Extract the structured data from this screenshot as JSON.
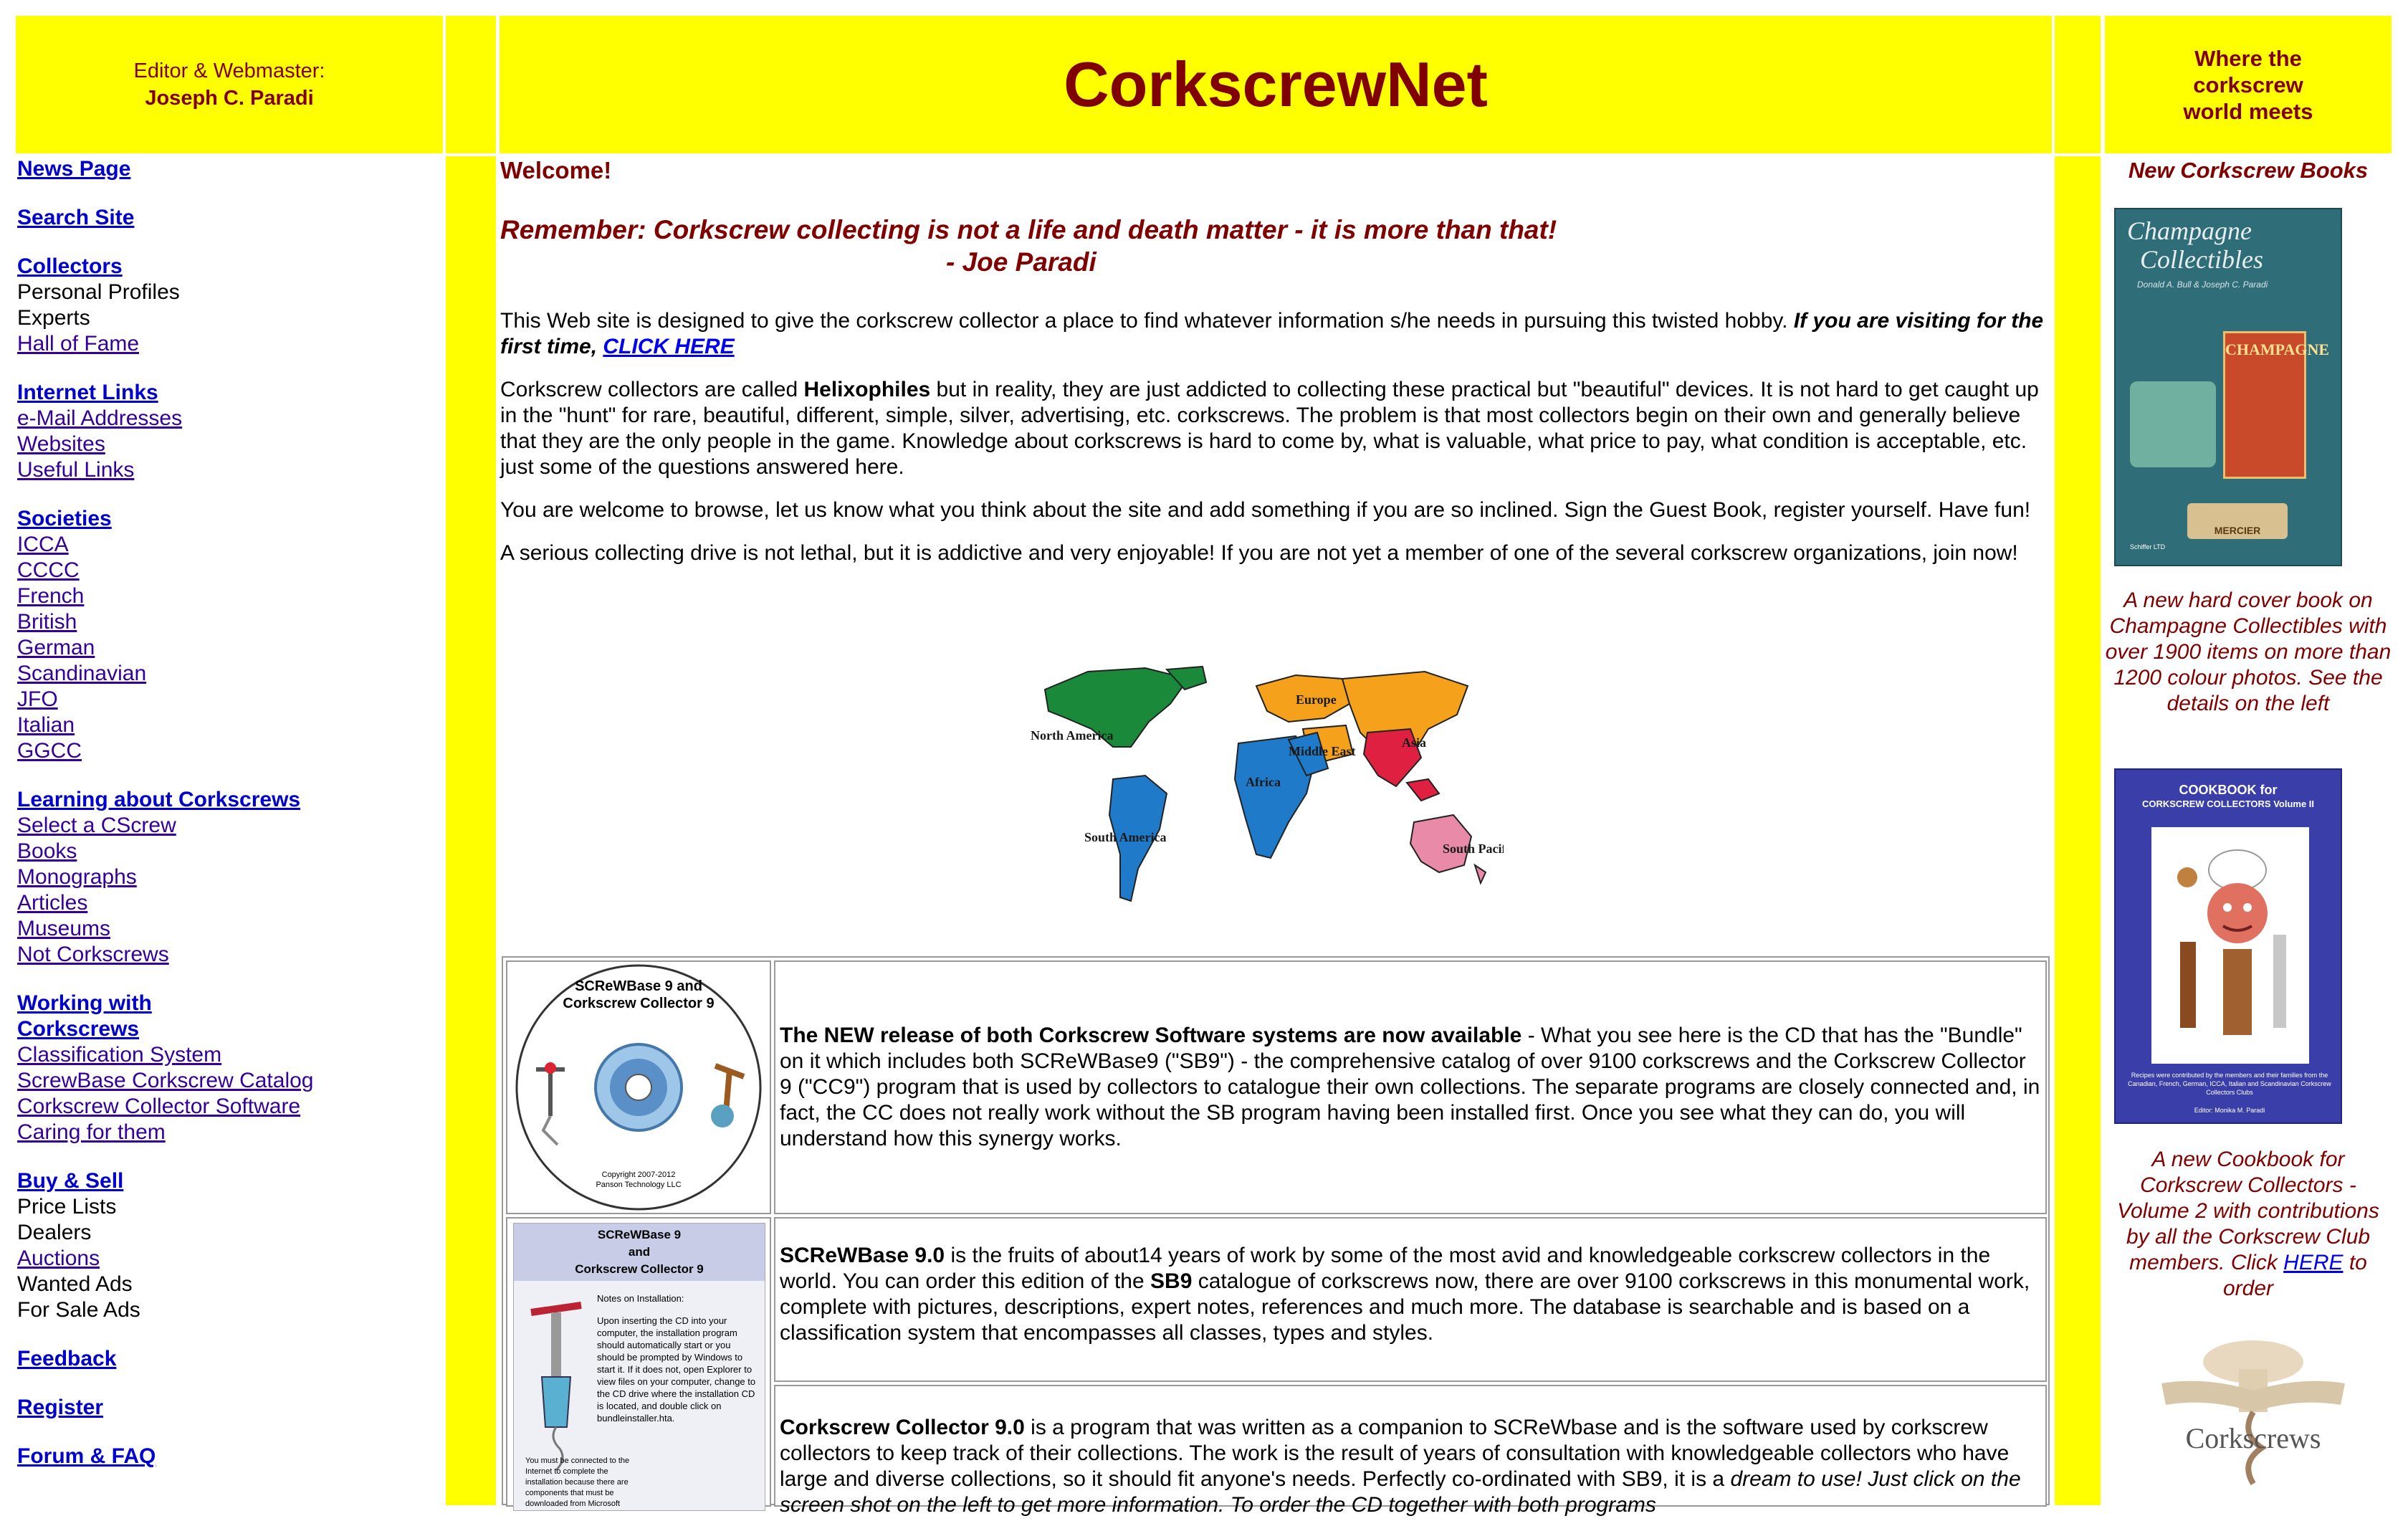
{
  "header": {
    "editor_label": "Editor & Webmaster:",
    "editor_name": "Joseph C. Paradi",
    "site_title": "CorkscrewNet",
    "tagline": "Where the corkscrew world meets"
  },
  "nav": {
    "news": "News Page",
    "search": "Search Site",
    "collectors": "Collectors",
    "personal_profiles": "Personal Profiles",
    "experts": "Experts",
    "hall_of_fame": "Hall of Fame",
    "internet_links": "Internet Links",
    "email_addresses": "e-Mail Addresses",
    "websites": "Websites",
    "useful_links": "Useful Links",
    "societies": "Societies",
    "society_items": [
      "ICCA",
      "CCCC",
      "French",
      "British",
      "German",
      "Scandinavian",
      "JFO",
      "Italian",
      "GGCC"
    ],
    "learning": "Learning about Corkscrews",
    "learning_items": [
      "Select a CScrew",
      "Books",
      "Monographs",
      "Articles",
      "Museums",
      "Not Corkscrews"
    ],
    "working_1": "Working with",
    "working_2": "Corkscrews",
    "working_items": [
      "Classification System",
      "ScrewBase Corkscrew Catalog",
      "Corkscrew Collector Software",
      "Caring for them"
    ],
    "buysell": "Buy & Sell",
    "price_lists": "Price Lists",
    "dealers": "Dealers",
    "auctions": "Auctions",
    "wanted_ads": "Wanted Ads",
    "for_sale_ads": "For Sale Ads",
    "feedback": "Feedback",
    "register": "Register",
    "forum": "Forum & FAQ"
  },
  "main": {
    "welcome": "Welcome!",
    "quote": "Remember: Corkscrew collecting is not a life and death matter - it is more than that!",
    "quote_author": "- Joe Paradi",
    "p1_text": "This Web site is designed to give the corkscrew collector a place to find whatever information s/he needs in pursuing this twisted hobby.  ",
    "p1_bold": "If you are visiting for the first time, ",
    "p1_link": "CLICK HERE",
    "p2_pre": "Corkscrew collectors are called ",
    "p2_bold": "Helixophiles",
    "p2_post": " but in reality, they are just addicted to collecting these practical but \"beautiful\" devices.  It is not hard to get caught up in the \"hunt\" for rare, beautiful, different, simple, silver, advertising, etc. corkscrews.  The problem is that most collectors begin on their own and generally believe that they are the only people in the game.  Knowledge about corkscrews is hard to come by, what is valuable, what price to pay, what condition is acceptable, etc. just some of the questions answered here.",
    "p3": "You are welcome to browse, let us know what you think about the site and add something if you are so inclined.  Sign the Guest Book, register yourself.  Have fun!",
    "p4": "A serious collecting drive is not lethal, but it is addictive and very enjoyable!   If you are not yet a member of one of the several corkscrew organizations, join now!",
    "map_labels": [
      "North America",
      "Europe",
      "Asia",
      "Middle East",
      "Africa",
      "South America",
      "South Pacific"
    ]
  },
  "software": {
    "cd_title_1": "SCReWBase 9 and",
    "cd_title_2": "Corkscrew Collector 9",
    "cd_copyright_1": "Copyright 2007-2012",
    "cd_copyright_2": "Panson Technology LLC",
    "r1_bold": "The NEW release of both Corkscrew Software systems are now available",
    "r1_text": " - What you see here is the CD that has the \"Bundle\" on it which includes both SCReWBase9 (\"SB9\") - the comprehensive catalog of over 9100 corkscrews and the Corkscrew Collector 9 (\"CC9\") program that is used by collectors to catalogue their own collections.  The separate programs are closely connected and, in fact, the CC does not really work without the SB program having been installed first.  Once you see what they can do, you will understand how this synergy works.",
    "sleeve_title_1": "SCReWBase 9",
    "sleeve_title_2": "and",
    "sleeve_title_3": "Corkscrew Collector 9",
    "sleeve_notes": "Notes on Installation:",
    "sleeve_body": "Upon inserting the CD into your computer, the installation program should automatically start or you should be prompted by Windows to start it. If it does not, open Explorer to view files on your computer, change to the CD drive where the installation CD is located, and double click on bundleinstaller.hta.",
    "sleeve_body2": "You must be connected to the Internet to complete the installation because there are components that must be downloaded from Microsoft",
    "r2_bold1": "SCReWBase 9.0",
    "r2_text1": " is the fruits of about14 years of work by some of the most avid and knowledgeable corkscrew collectors in the world.  You can order this edition of the ",
    "r2_bold2": "SB9",
    "r2_text2": " catalogue of corkscrews now, there are over 9100 corkscrews in this monumental work, complete with pictures, descriptions, expert notes, references and much more.  The database is searchable and is based on a classification system that encompasses all classes, types and styles.",
    "r3_bold": "Corkscrew Collector 9.0",
    "r3_text": " is a program that was written as a companion to SCReWbase and is the software used by corkscrew collectors to keep track of their collections.  The work is the result of years of consultation with knowledgeable collectors who have large and diverse collections, so it should fit anyone's needs.  Perfectly co-ordinated with SB9, it is a ",
    "r3_italic": "dream to use!  Just click on the screen shot on the left to get more information.  To order the CD together with both programs"
  },
  "right": {
    "head": "New Corkscrew Books",
    "book1_title_1": "Champagne",
    "book1_title_2": "Collectibles",
    "book1_authors": "Donald A. Bull & Joseph C. Paradi",
    "book1_label": "CHAMPAGNE",
    "book1_mercier": "MERCIER",
    "book1_publisher": "Schiffer LTD",
    "cap1": "A new hard cover book on Champagne Collectibles with over 1900 items on more than 1200 colour photos. See the details on the left",
    "book2_title_1": "COOKBOOK for",
    "book2_title_2": "CORKSCREW COLLECTORS Volume II",
    "book2_foot": "Recipes were contributed by the members and their families from the Canadian, French, German, ICCA, Italian and Scandinavian Corkscrew Collectors Clubs",
    "book2_editor": "Editor: Monika M. Paradi",
    "cap2_pre": "A new Cookbook for Corkscrew Collectors - Volume 2 with contributions by all the Corkscrew Club members.  Click ",
    "cap2_link": "HERE",
    "cap2_post": " to order",
    "book3_title": "Corkscrews"
  },
  "colors": {
    "yellow": "#ffff00",
    "maroon": "#800000",
    "link": "#330099"
  }
}
